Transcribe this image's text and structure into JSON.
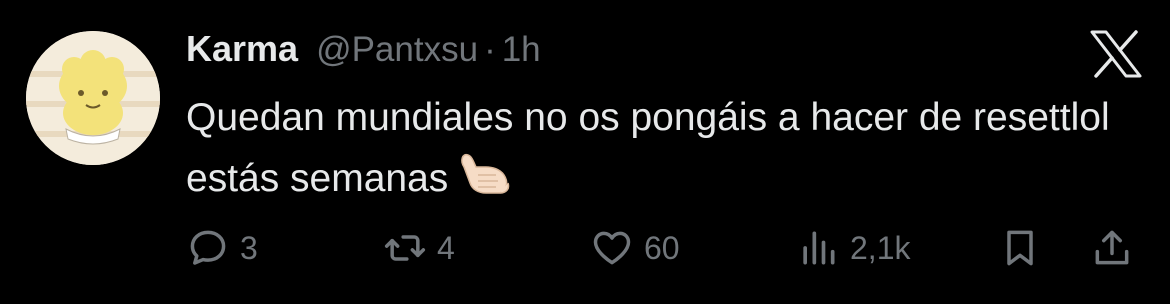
{
  "tweet": {
    "author_name": "Karma",
    "handle": "@Pantxsu",
    "separator": "·",
    "time": "1h",
    "text": "Quedan mundiales no os pongáis a hacer de resettlol estás semanas",
    "emoji": "call-me-hand-emoji"
  },
  "actions": {
    "replies": "3",
    "retweets": "4",
    "likes": "60",
    "views": "2,1k"
  },
  "colors": {
    "background": "#000000",
    "primary_text": "#e7e9ea",
    "secondary_text": "#71767b"
  }
}
